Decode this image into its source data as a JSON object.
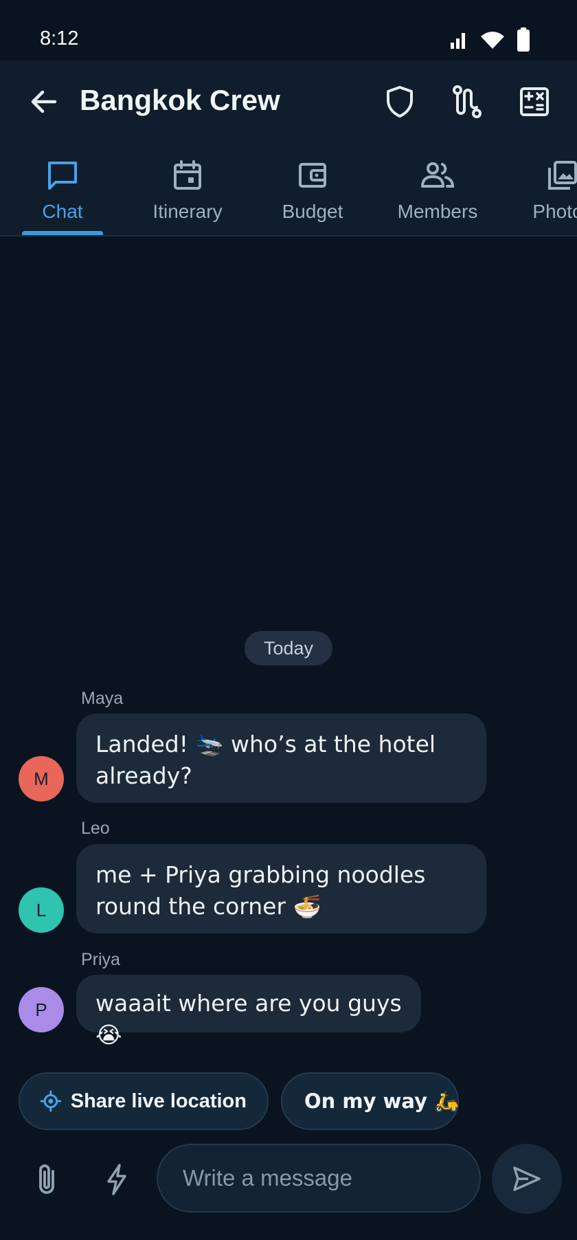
{
  "status_bar": {
    "time": "8:12"
  },
  "header": {
    "title": "Bangkok Crew",
    "actions": [
      "shield-icon",
      "route-icon",
      "calculator-icon"
    ]
  },
  "tabs": [
    {
      "label": "Chat",
      "icon": "chat-bubble-icon",
      "active": true
    },
    {
      "label": "Itinerary",
      "icon": "calendar-icon",
      "active": false
    },
    {
      "label": "Budget",
      "icon": "wallet-icon",
      "active": false
    },
    {
      "label": "Members",
      "icon": "people-icon",
      "active": false
    },
    {
      "label": "Photos",
      "icon": "photo-library-icon",
      "active": false
    }
  ],
  "chat": {
    "date_divider": "Today",
    "messages": [
      {
        "sender": "Maya",
        "initial": "M",
        "avatar_color": "#e8665a",
        "text": "Landed! 🛬 who’s at the hotel already?"
      },
      {
        "sender": "Leo",
        "initial": "L",
        "avatar_color": "#2ec4b0",
        "text": "me + Priya grabbing noodles round the corner 🍜"
      },
      {
        "sender": "Priya",
        "initial": "P",
        "avatar_color": "#a98be8",
        "text": "waaait where are you guys 😭"
      }
    ]
  },
  "quick_replies": [
    {
      "label": "Share live location",
      "icon": "location-target-icon"
    },
    {
      "label": "On my way 🛵",
      "icon": ""
    }
  ],
  "composer": {
    "placeholder": "Write a message",
    "attach_icon": "paperclip-icon",
    "quick_icon": "lightning-icon",
    "send_icon": "send-icon"
  },
  "colors": {
    "background": "#0a1420",
    "app_bar": "#0f1d2c",
    "accent": "#3a9be0",
    "bubble": "#1d2a39"
  }
}
